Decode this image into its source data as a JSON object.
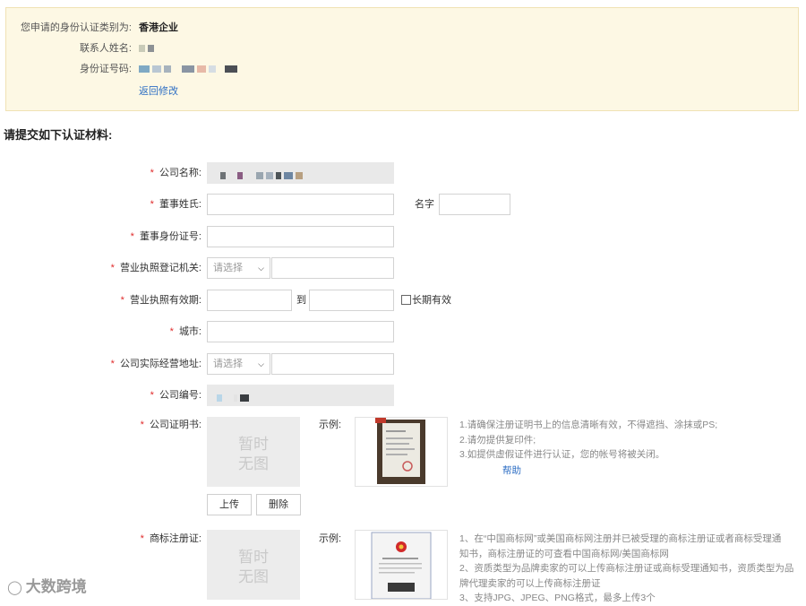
{
  "notice": {
    "type_label": "您申请的身份认证类别为:",
    "type_value": "香港企业",
    "contact_label": "联系人姓名:",
    "id_label": "身份证号码:",
    "back_link": "返回修改"
  },
  "section_title": "请提交如下认证材料:",
  "form": {
    "company_name_label": "公司名称:",
    "director_surname_label": "董事姓氏:",
    "given_name_label": "名字",
    "director_id_label": "董事身份证号:",
    "license_authority_label": "营业执照登记机关:",
    "license_authority_placeholder": "请选择",
    "license_validity_label": "营业执照有效期:",
    "to_label": "到",
    "long_term_label": "长期有效",
    "city_label": "城市:",
    "address_label": "公司实际经营地址:",
    "address_placeholder": "请选择",
    "company_no_label": "公司编号:",
    "certificate_label": "公司证明书:",
    "trademark_label": "商标注册证:",
    "example_label": "示例:",
    "no_image_text_1": "暂时",
    "no_image_text_2": "无图",
    "upload_button": "上传",
    "delete_button": "删除",
    "help_link": "帮助"
  },
  "certificate_notes": [
    "1.请确保注册证明书上的信息清晰有效，不得遮挡、涂抹或PS;",
    "2.请勿提供复印件;",
    "3.如提供虚假证件进行认证，您的帐号将被关闭。"
  ],
  "trademark_notes": [
    "1、在“中国商标网”或美国商标网注册并已被受理的商标注册证或者商标受理通",
    "知书，商标注册证的可查看中国商标网/美国商标网",
    "2、资质类型为品牌卖家的可以上传商标注册证或商标受理通知书，资质类型为品",
    "牌代理卖家的可以上传商标注册证",
    "3、支持JPG、JPEG、PNG格式，最多上传3个"
  ],
  "watermark": "大数跨境",
  "colors": {
    "required": "#e02b2b",
    "link": "#2f6fc4",
    "notice_bg": "#fdf8e4"
  }
}
